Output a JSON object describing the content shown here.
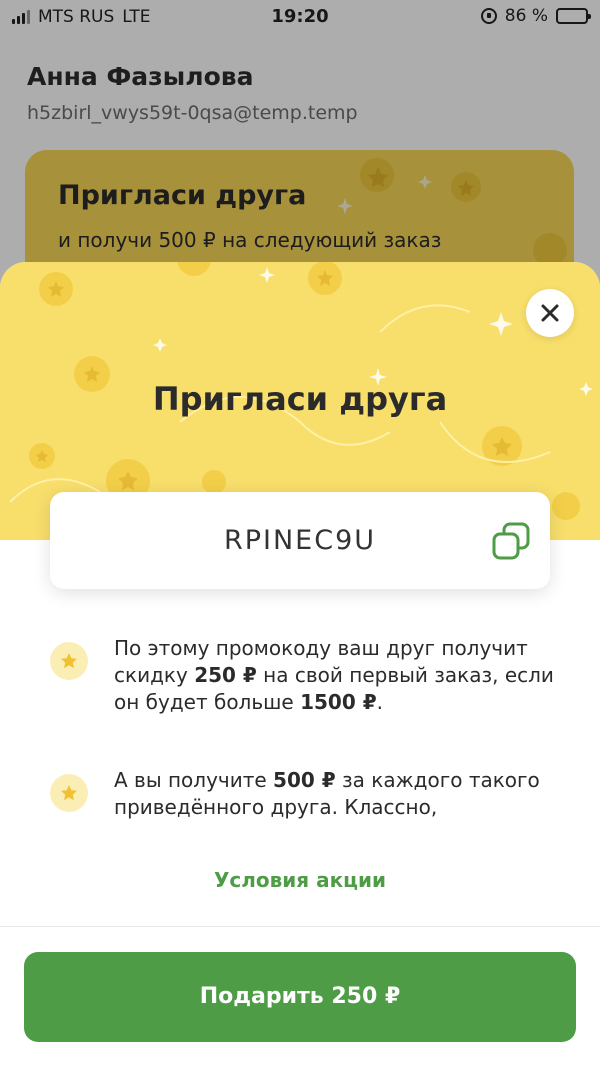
{
  "status_bar": {
    "carrier": "MTS RUS",
    "network": "LTE",
    "time": "19:20",
    "battery_text": "86 %",
    "battery_level": 0.86
  },
  "profile": {
    "name": "Анна Фазылова",
    "email": "h5zbirl_vwys59t-0qsa@temp.temp"
  },
  "background_promo": {
    "title": "Пригласи друга",
    "subtitle": "и получи 500 ₽ на следующий заказ"
  },
  "sheet": {
    "title": "Пригласи друга",
    "promo_code": "RPINEC9U",
    "benefits": [
      {
        "t1": "По этому промокоду ваш друг получит скидку ",
        "b1": "250 ₽",
        "t2": " на свой первый заказ, если он будет больше ",
        "b2": "1500 ₽",
        "t3": "."
      },
      {
        "t1": "А вы получите ",
        "b1": "500 ₽",
        "t2": " за каждого такого приведённого друга. Классно,",
        "b2": "",
        "t3": ""
      }
    ],
    "terms_link": "Условия акции",
    "gift_button": "Подарить 250 ₽"
  },
  "icons": {
    "close": "close-icon",
    "copy": "copy-icon",
    "benefit": "star-icon"
  },
  "colors": {
    "accent_green": "#4e9d46",
    "header_yellow": "#f8de6b",
    "star_badge_bg": "#fbeeb4"
  }
}
